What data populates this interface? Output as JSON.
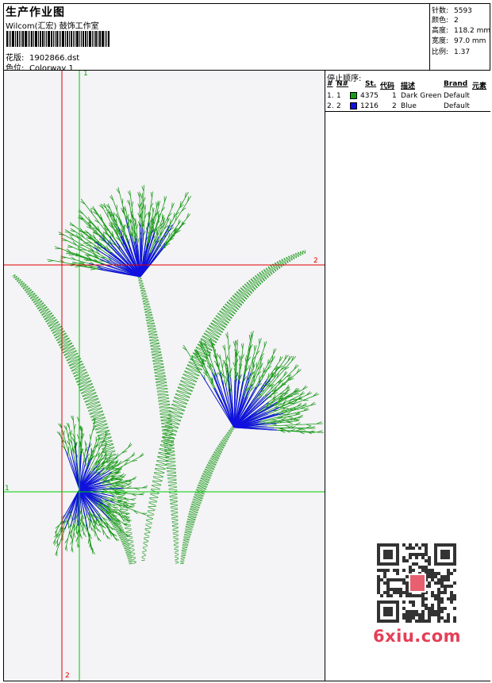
{
  "header": {
    "title": "生产作业图",
    "subtitle": "Wilcom(汇宏) 鼓饰工作室",
    "design_label": "花版:",
    "design_value": "1902866.dst",
    "colorway_label": "色位:",
    "colorway_value": "Colorway 1"
  },
  "stats": [
    {
      "label": "针数:",
      "value": "5593"
    },
    {
      "label": "颜色:",
      "value": "2"
    },
    {
      "label": "高度:",
      "value": "118.2 mm"
    },
    {
      "label": "宽度:",
      "value": "97.0 mm"
    },
    {
      "label": "比例:",
      "value": "1.37"
    }
  ],
  "stop_sequence": {
    "title": "停止顺序:",
    "columns": [
      "#",
      "N#",
      "St.",
      "代码",
      "描述",
      "Brand",
      "元素"
    ],
    "rows": [
      {
        "num": "1.",
        "n": "1",
        "color": "#1a9a1a",
        "stitches": "4375",
        "code": "1",
        "desc": "Dark Green",
        "brand": "Default"
      },
      {
        "num": "2.",
        "n": "2",
        "color": "#1010e0",
        "stitches": "1216",
        "code": "2",
        "desc": "Blue",
        "brand": "Default"
      }
    ]
  },
  "guides": {
    "top_label": "1",
    "right_label": "2",
    "bottom_label": "2",
    "left_label": "1"
  },
  "colors": {
    "green_thread": "#1a9a1a",
    "blue_thread": "#1010e0",
    "guide_red": "#e00000",
    "guide_green": "#00cc00",
    "brand": "#e43f57"
  },
  "watermark": {
    "text": "6xiu.com"
  }
}
